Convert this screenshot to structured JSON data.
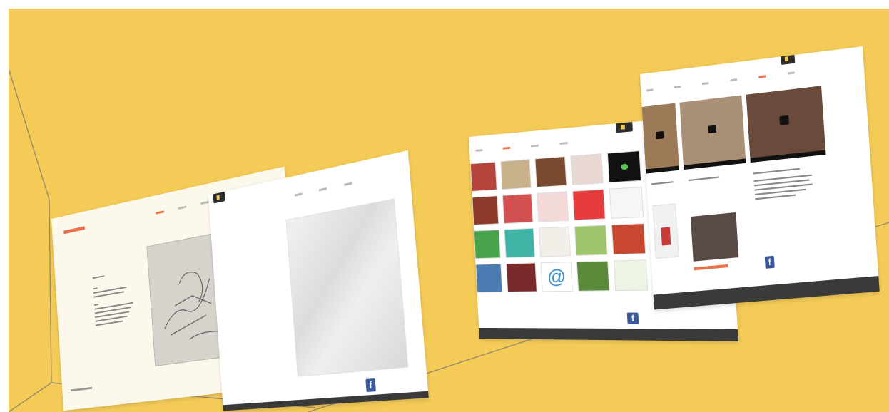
{
  "colors": {
    "background": "#f4cb57",
    "panel": "#ffffff",
    "panel_warm": "#fdf8ec",
    "footer": "#3a3a3a",
    "accent": "#e8704a",
    "facebook": "#3b5998"
  },
  "panels": {
    "p1": {
      "nav": [
        "",
        "",
        "",
        "",
        "",
        ""
      ],
      "fb_icon": "f",
      "fb_text": ""
    },
    "p2": {
      "nav": [
        "",
        "",
        ""
      ],
      "pill_label": "",
      "fb_icon": "f",
      "fb_text": ""
    },
    "p3": {
      "nav": [
        "",
        "",
        "",
        "",
        ""
      ],
      "pill_label": "",
      "fb_icon": "f",
      "fb_text": "",
      "footer_text": "",
      "at_glyph": "@"
    },
    "p4": {
      "nav": [
        "",
        "",
        "",
        "",
        "",
        ""
      ],
      "pill_label": "",
      "fb_icon": "f",
      "fb_text": "",
      "footer_text": ""
    }
  },
  "icons": [
    "facebook-icon",
    "video-play-icon"
  ]
}
